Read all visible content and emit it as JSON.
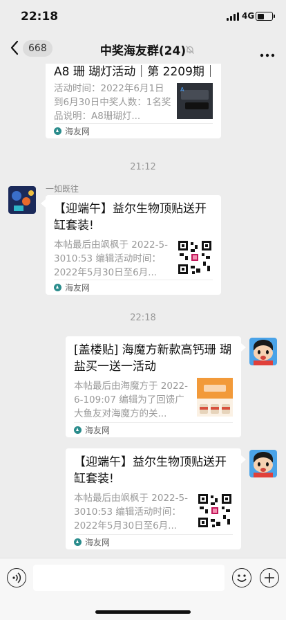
{
  "status_bar": {
    "time": "22:18",
    "network": "4G"
  },
  "nav": {
    "back_count": "668",
    "title": "中奖海友群(24)"
  },
  "messages": [
    {
      "title": "A8 珊 瑚灯活动｜第 2209期｜",
      "desc": "活动时间：2022年6月1日到6月30日中奖人数：1名奖品说明：A8珊瑚灯...",
      "source": "海友网"
    },
    {
      "timestamp": "21:12"
    },
    {
      "sender": "一如既往",
      "title": "【迎端午】益尔生物顶贴送开缸套装!",
      "desc": "本帖最后由飒枫于 2022-5-3010:53 编辑活动时间：2022年5月30日至6月...",
      "source": "海友网"
    },
    {
      "timestamp": "22:18"
    },
    {
      "title": "[盖楼贴] 海魔方新款高钙珊 瑚盐买一送一活动",
      "desc": "本帖最后由海魔方于 2022-6-109:07 编辑为了回馈广大鱼友对海魔方的关...",
      "source": "海友网"
    },
    {
      "title": "【迎端午】益尔生物顶贴送开缸套装!",
      "desc": "本帖最后由飒枫于 2022-5-3010:53 编辑活动时间：2022年5月30日至6月...",
      "source": "海友网"
    }
  ],
  "input": {
    "placeholder": ""
  },
  "colors": {
    "background": "#ededed",
    "card": "#ffffff",
    "muted_text": "#999999",
    "source_icon": "#2a8c8c"
  }
}
